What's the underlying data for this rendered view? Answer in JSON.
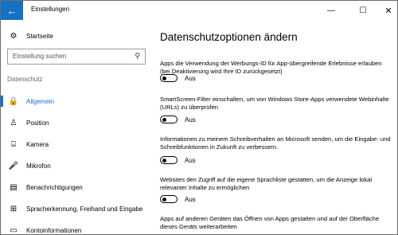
{
  "window": {
    "title": "Einstellungen",
    "back_icon": "←",
    "minimize_icon": "—",
    "maximize_icon": "☐",
    "close_icon": "✕"
  },
  "sidebar": {
    "home": {
      "icon": "⚙",
      "label": "Startseite"
    },
    "search": {
      "placeholder": "Einstellung suchen",
      "icon": "⚲"
    },
    "group_label": "Datenschutz",
    "items": [
      {
        "icon": "🔒",
        "label": "Allgemein",
        "active": true
      },
      {
        "icon": "♙",
        "label": "Position"
      },
      {
        "icon": "⌸",
        "label": "Kamera"
      },
      {
        "icon": "🎤",
        "label": "Mikrofon"
      },
      {
        "icon": "▤",
        "label": "Benachrichtigungen"
      },
      {
        "icon": "⊞",
        "label": "Spracherkennung, Freihand und Eingabe"
      },
      {
        "icon": "▭",
        "label": "Kontoinformationen"
      }
    ],
    "accent_color": "#1570c6"
  },
  "main": {
    "heading": "Datenschutzoptionen ändern",
    "settings": [
      {
        "text": "Apps die Verwendung der Werbungs-ID für App-übergreifende Erlebnisse erlauben (bei Deaktivierung wird Ihre ID zurückgesetzt)",
        "state": "Aus"
      },
      {
        "text": "SmartScreen-Filter einschalten, um von Windows Store-Apps verwendete Webinhalte (URLs) zu überprüfen",
        "state": "Aus"
      },
      {
        "text": "Informationen zu meinem Schreibverhalten an Microsoft senden, um die Eingabe- und Schreibfunktionen in Zukunft zu verbessern.",
        "state": "Aus"
      },
      {
        "text": "Websites den Zugriff auf die eigene Sprachliste gestatten, um die Anzeige lokal relevanter Inhalte zu ermöglichen",
        "state": "Aus"
      },
      {
        "text": "Apps auf anderen Geräten das Öffnen von Apps gestatten und auf der Oberfläche dieses Geräts weiterarbeiten",
        "state": ""
      }
    ]
  }
}
